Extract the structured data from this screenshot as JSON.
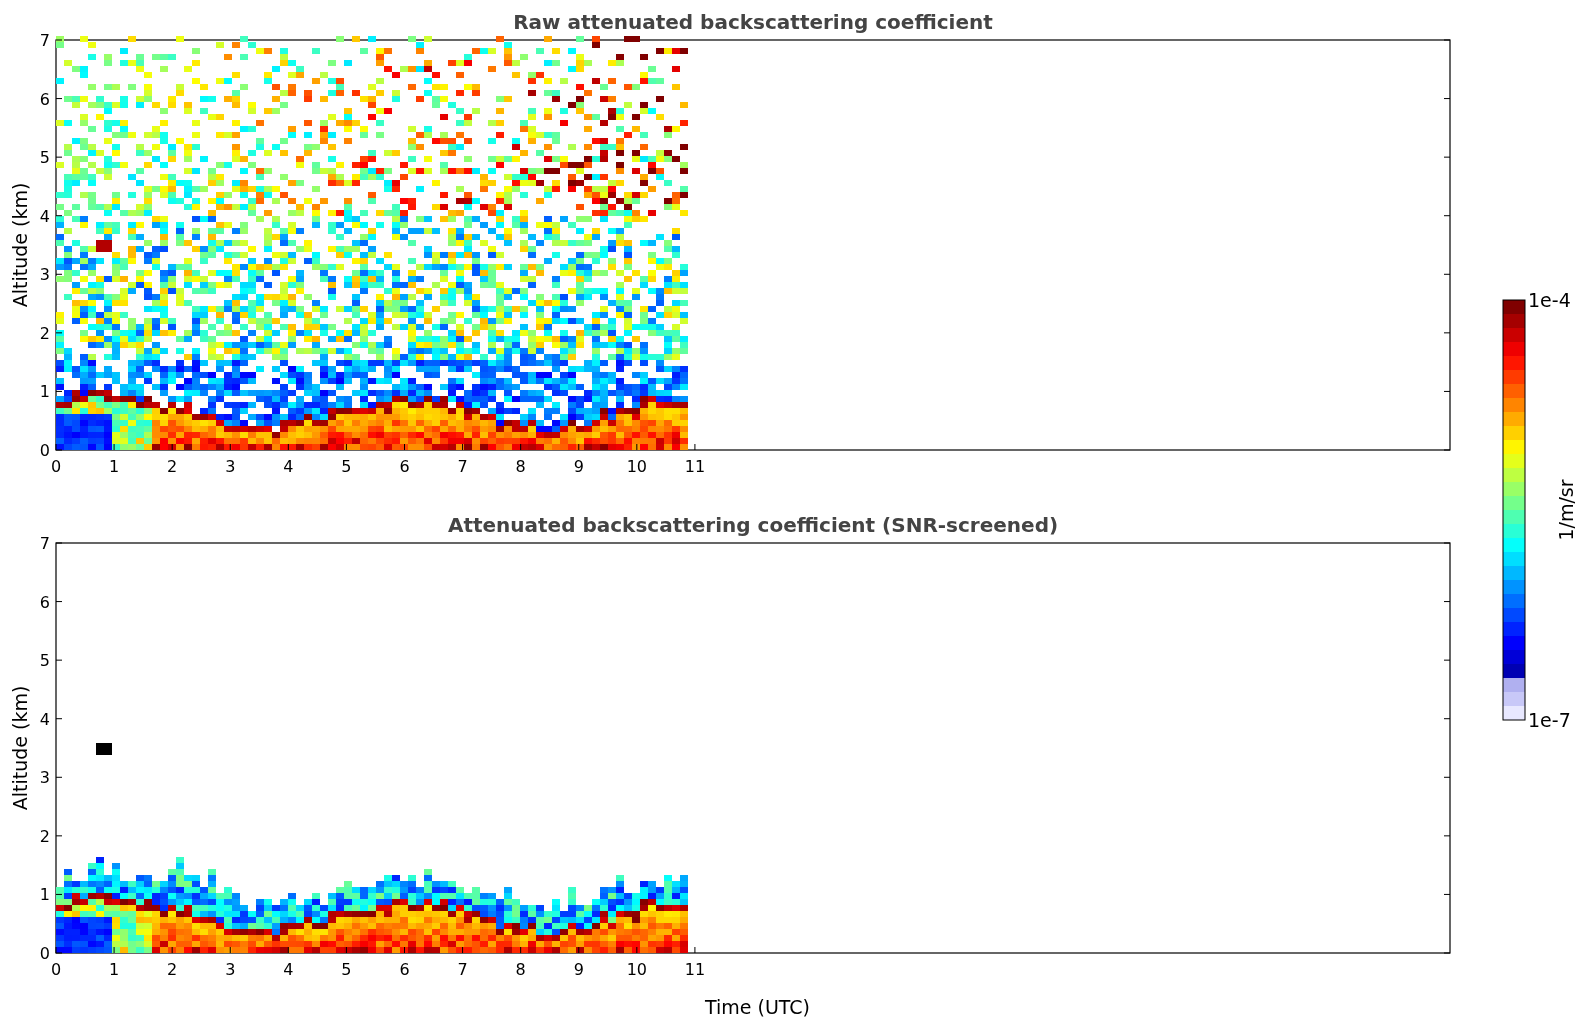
{
  "panels": [
    {
      "kind": "raw",
      "title": "Raw attenuated backscattering coefficient",
      "ylabel": "Altitude (km)",
      "yticks": [
        "7",
        "6",
        "5",
        "4",
        "3",
        "2",
        "1",
        "0"
      ],
      "xticks": [
        "0",
        "1",
        "2",
        "3",
        "4",
        "5",
        "6",
        "7",
        "8",
        "9",
        "10",
        "11"
      ]
    },
    {
      "kind": "screened",
      "title": "Attenuated backscattering coefficient (SNR-screened)",
      "ylabel": "Altitude (km)",
      "yticks": [
        "7",
        "6",
        "5",
        "4",
        "3",
        "2",
        "1",
        "0"
      ],
      "xticks": [
        "0",
        "1",
        "2",
        "3",
        "4",
        "5",
        "6",
        "7",
        "8",
        "9",
        "10",
        "11"
      ]
    }
  ],
  "xlabel": "Time (UTC)",
  "colorbar": {
    "max_label": "1e-4",
    "min_label": "1e-7",
    "label": "1/m/sr"
  }
}
